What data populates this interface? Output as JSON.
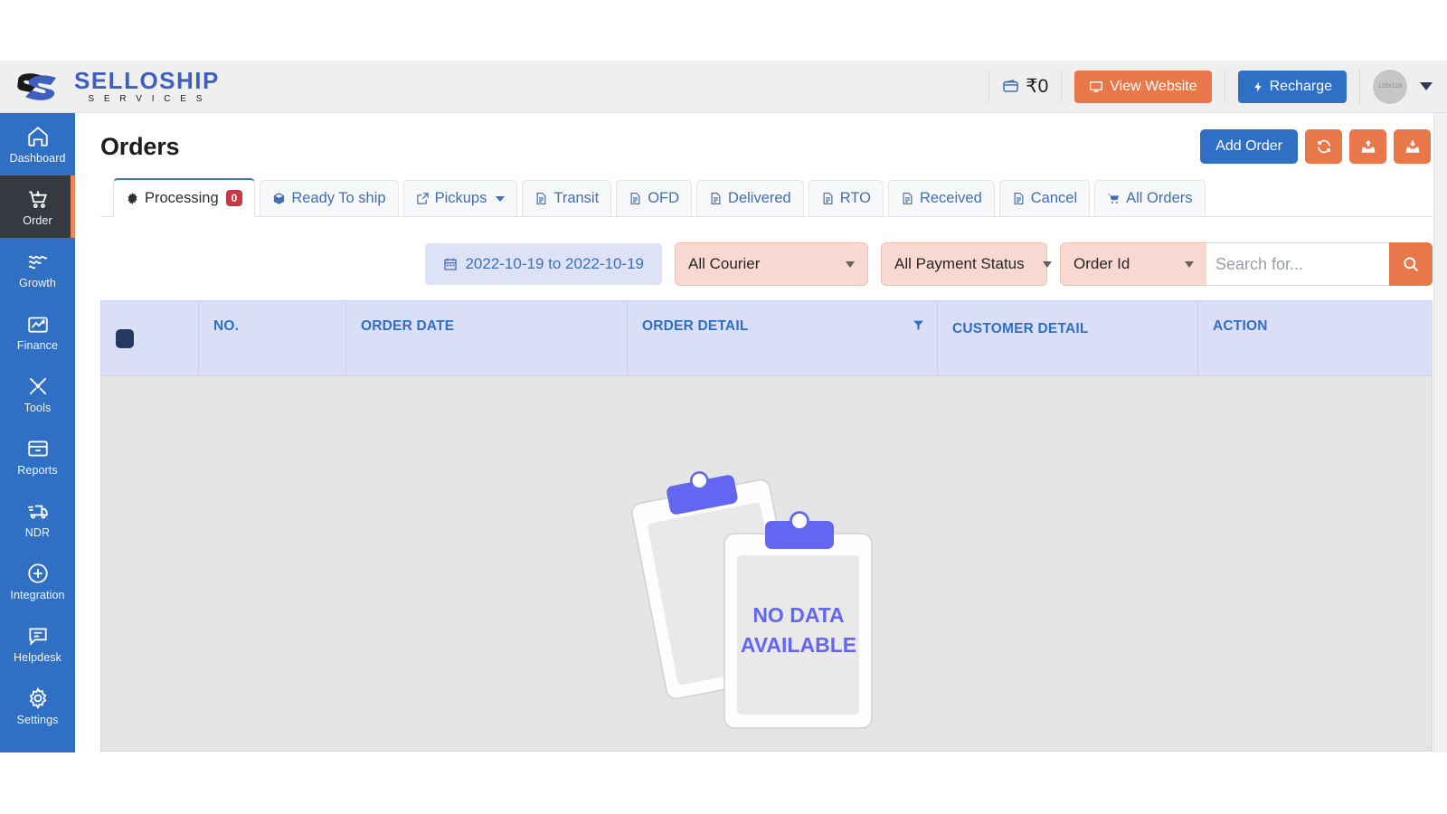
{
  "brand": {
    "name": "SELLOSHIP",
    "tagline": "S E R V I C E S"
  },
  "topbar": {
    "wallet_amount": "₹0",
    "wallet_icon": "wallet-icon",
    "view_website_label": "View Website",
    "view_website_icon": "monitor-icon",
    "recharge_label": "Recharge",
    "recharge_icon": "bolt-icon",
    "avatar_label": "128x128",
    "avatar_caret_icon": "caret-down-icon",
    "orange": "#e8784a",
    "blue": "#2f6fc4"
  },
  "sidebar": {
    "items": [
      {
        "label": "Dashboard",
        "icon": "home-icon",
        "active": false
      },
      {
        "label": "Order",
        "icon": "cart-icon",
        "active": true
      },
      {
        "label": "Growth",
        "icon": "growth-icon",
        "active": false
      },
      {
        "label": "Finance",
        "icon": "finance-icon",
        "active": false
      },
      {
        "label": "Tools",
        "icon": "tools-icon",
        "active": false
      },
      {
        "label": "Reports",
        "icon": "archive-icon",
        "active": false
      },
      {
        "label": "NDR",
        "icon": "truck-icon",
        "active": false
      },
      {
        "label": "Integration",
        "icon": "plus-circle-icon",
        "active": false
      },
      {
        "label": "Helpdesk",
        "icon": "chat-icon",
        "active": false
      },
      {
        "label": "Settings",
        "icon": "gear-icon",
        "active": false
      }
    ]
  },
  "page": {
    "title": "Orders",
    "add_order_label": "Add Order",
    "refresh_icon": "refresh-icon",
    "upload_icon": "upload-icon",
    "download_icon": "download-icon"
  },
  "tabs": [
    {
      "label": "Processing",
      "icon": "gear-icon",
      "badge": "0",
      "active": true,
      "dropdown": false
    },
    {
      "label": "Ready To ship",
      "icon": "box-icon",
      "badge": "",
      "active": false,
      "dropdown": false
    },
    {
      "label": "Pickups",
      "icon": "external-link-icon",
      "badge": "",
      "active": false,
      "dropdown": true
    },
    {
      "label": "Transit",
      "icon": "document-icon",
      "badge": "",
      "active": false,
      "dropdown": false
    },
    {
      "label": "OFD",
      "icon": "document-icon",
      "badge": "",
      "active": false,
      "dropdown": false
    },
    {
      "label": "Delivered",
      "icon": "document-icon",
      "badge": "",
      "active": false,
      "dropdown": false
    },
    {
      "label": "RTO",
      "icon": "document-icon",
      "badge": "",
      "active": false,
      "dropdown": false
    },
    {
      "label": "Received",
      "icon": "document-icon",
      "badge": "",
      "active": false,
      "dropdown": false
    },
    {
      "label": "Cancel",
      "icon": "document-icon",
      "badge": "",
      "active": false,
      "dropdown": false
    },
    {
      "label": "All Orders",
      "icon": "cart-icon",
      "badge": "",
      "active": false,
      "dropdown": false
    }
  ],
  "filters": {
    "date_range": "2022-10-19 to 2022-10-19",
    "calendar_icon": "calendar-icon",
    "courier_selected": "All Courier",
    "payment_selected": "All Payment Status",
    "search_field_selected": "Order Id",
    "search_placeholder": "Search for...",
    "search_value": "",
    "search_icon": "search-icon"
  },
  "table": {
    "columns": [
      "",
      "NO.",
      "ORDER DATE",
      "ORDER DETAIL",
      "CUSTOMER DETAIL",
      "ACTION"
    ],
    "select_all_checked": true,
    "filter_icon": "funnel-icon",
    "rows": [],
    "empty_text_line1": "NO DATA",
    "empty_text_line2": "AVAILABLE",
    "empty_illustration": "clipboard-empty-icon"
  }
}
